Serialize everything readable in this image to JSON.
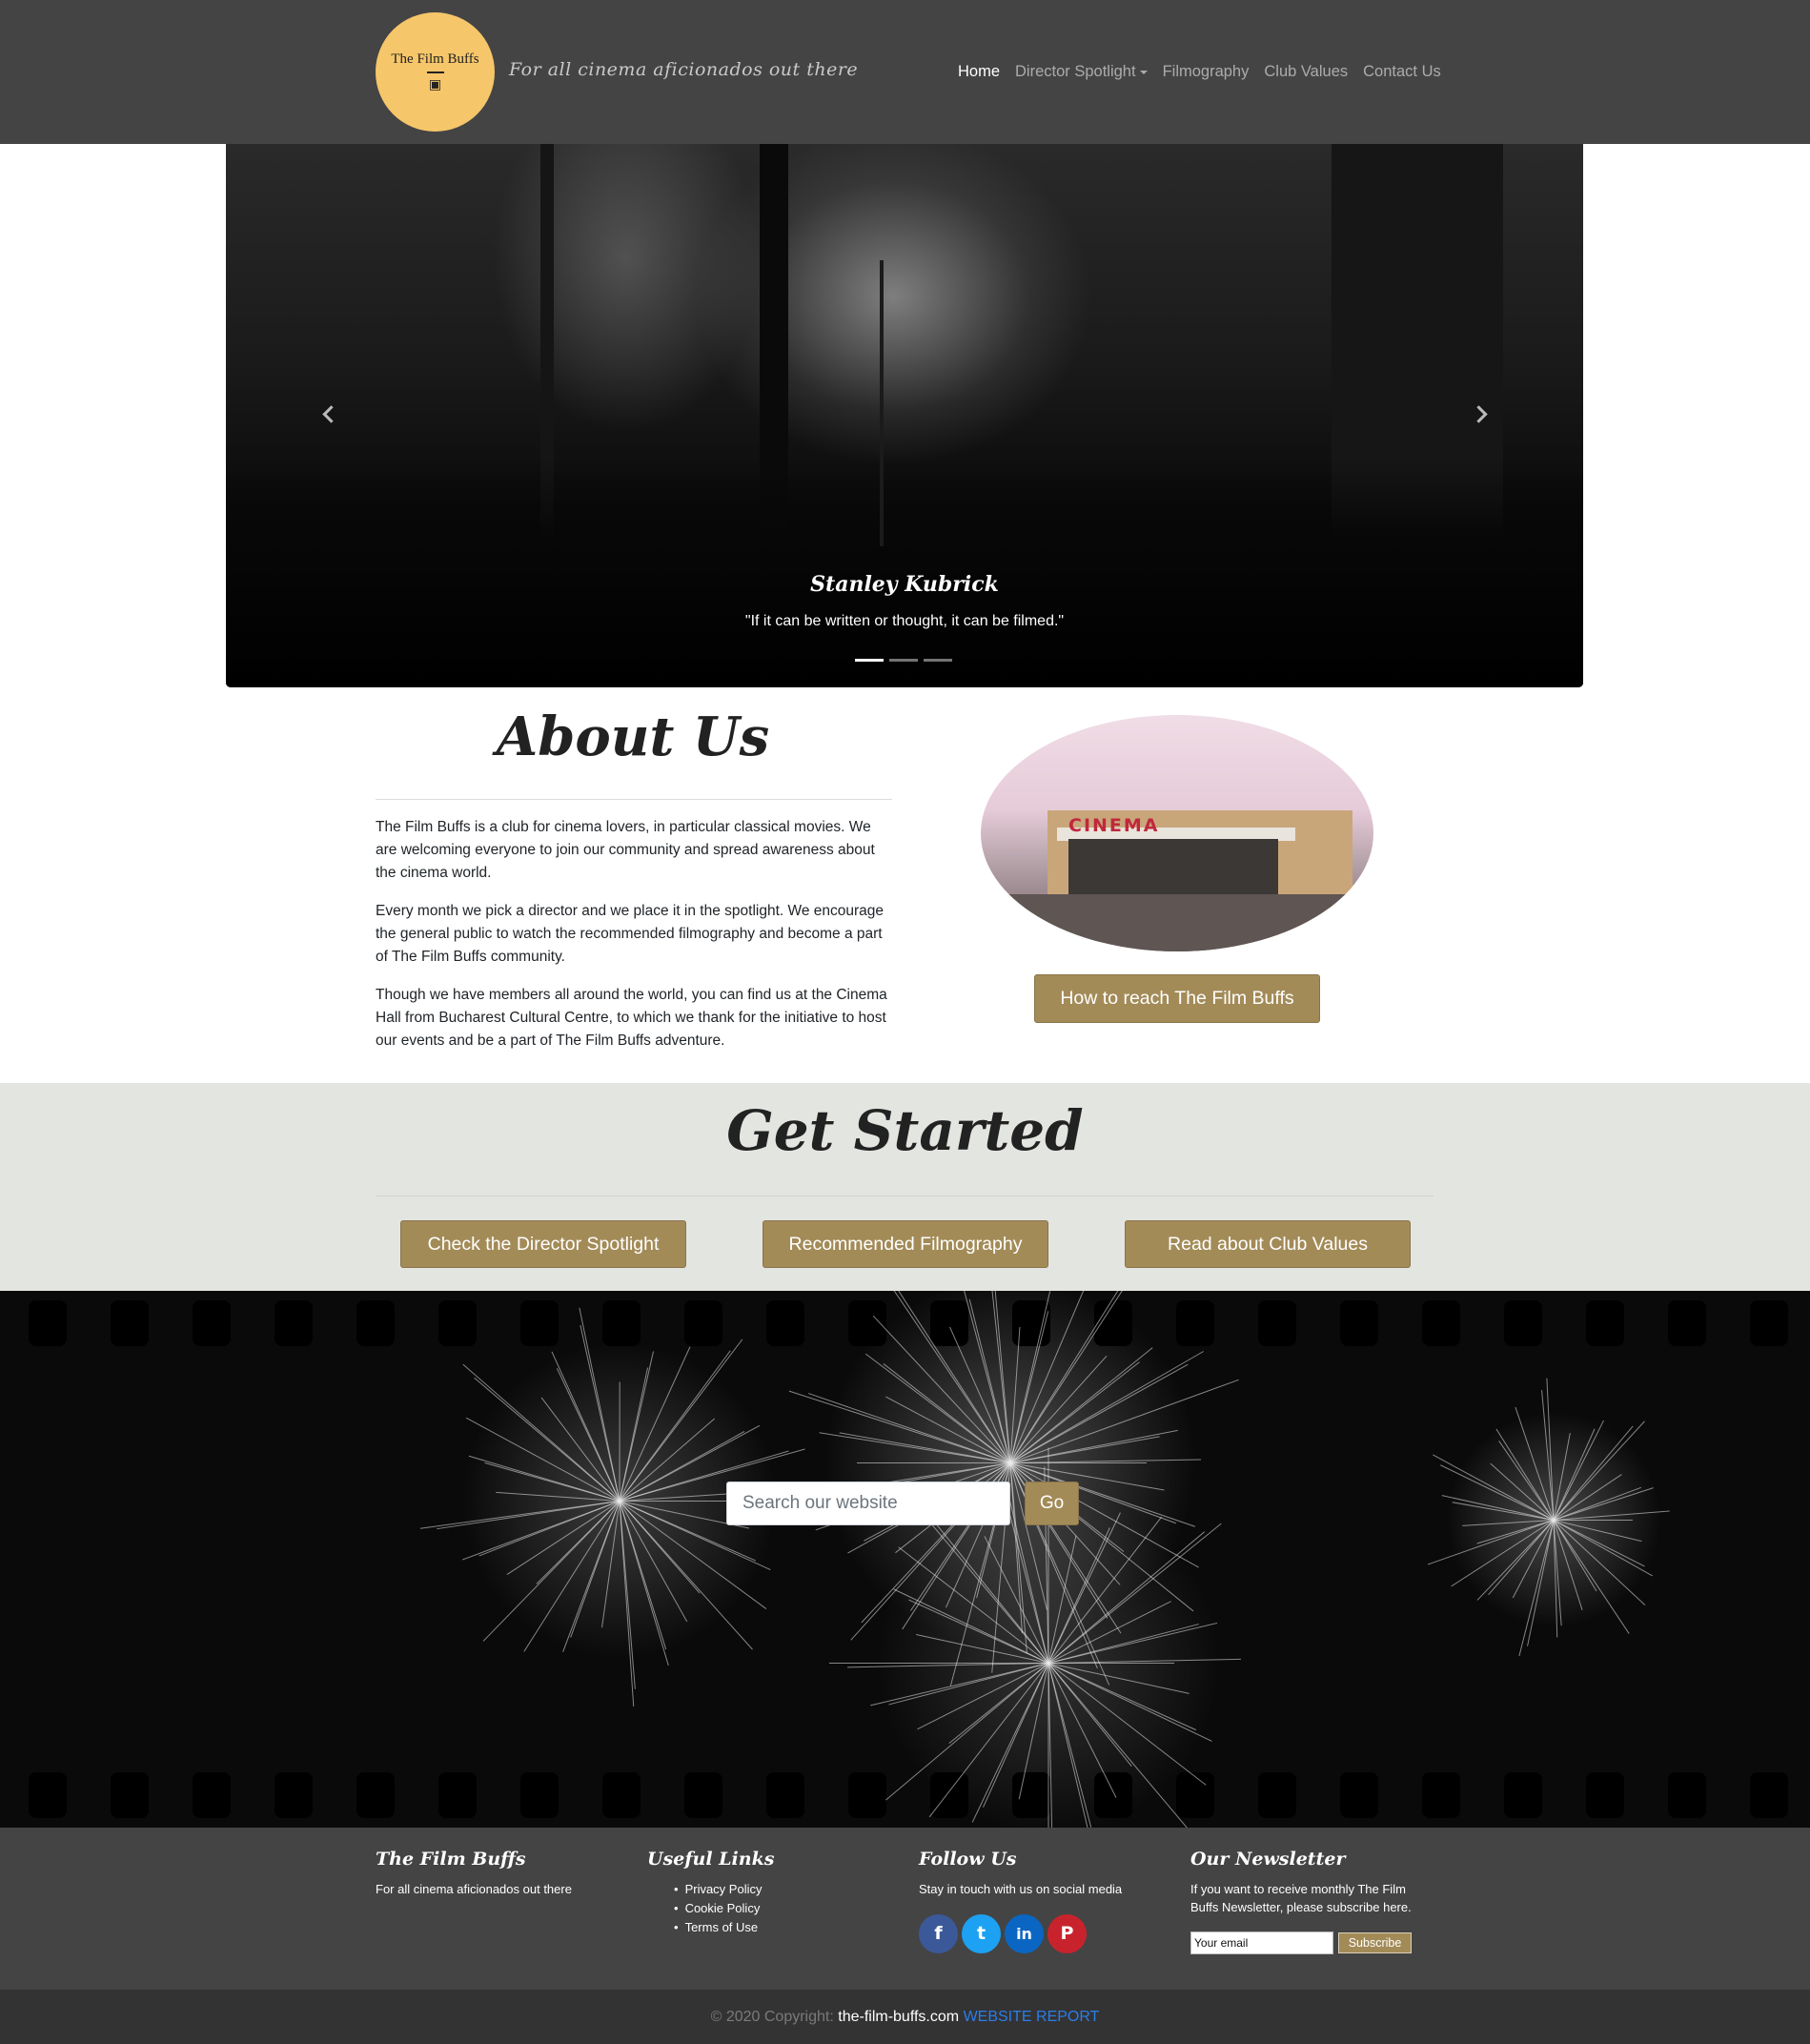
{
  "navbar": {
    "logo_text": "The Film Buffs",
    "tagline": "For all cinema aficionados out there",
    "links": [
      {
        "label": "Home",
        "active": true
      },
      {
        "label": "Director Spotlight",
        "dropdown": true
      },
      {
        "label": "Filmography"
      },
      {
        "label": "Club Values"
      },
      {
        "label": "Contact Us"
      }
    ]
  },
  "carousel": {
    "caption_title": "Stanley Kubrick",
    "caption_text": "\"If it can be written or thought, it can be filmed.\"",
    "slide_count": 3,
    "active_slide": 1
  },
  "about": {
    "title": "About Us",
    "paragraphs": [
      "The Film Buffs is a club for cinema lovers, in particular classical movies. We are welcoming everyone to join our community and spread awareness about the cinema world.",
      "Every month we pick a director and we place it in the spotlight. We encourage the general public to watch the recommended filmography and become a part of The Film Buffs community.",
      "Though we have members all around the world, you can find us at the Cinema Hall from Bucharest Cultural Centre, to which we thank for the initiative to host our events and be a part of The Film Buffs adventure."
    ],
    "image_sign": "CINEMA",
    "button": "How to reach The Film Buffs"
  },
  "get_started": {
    "title": "Get Started",
    "buttons": [
      "Check the Director Spotlight",
      "Recommended Filmography",
      "Read about Club Values"
    ]
  },
  "search": {
    "placeholder": "Search our website",
    "button": "Go"
  },
  "footer": {
    "col1": {
      "title": "The Film Buffs",
      "text": "For all cinema aficionados out there"
    },
    "col2": {
      "title": "Useful Links",
      "links": [
        "Privacy Policy",
        "Cookie Policy",
        "Terms of Use"
      ]
    },
    "col3": {
      "title": "Follow Us",
      "text": "Stay in touch with us on social media",
      "social": [
        {
          "icon": "facebook-icon",
          "glyph": "f",
          "color": "#3b5998"
        },
        {
          "icon": "twitter-icon",
          "glyph": "t",
          "color": "#1da1f2"
        },
        {
          "icon": "linkedin-icon",
          "glyph": "in",
          "color": "#0a66c2"
        },
        {
          "icon": "pinterest-icon",
          "glyph": "P",
          "color": "#c8232c"
        }
      ]
    },
    "col4": {
      "title": "Our Newsletter",
      "text": "If you want to receive monthly The Film Buffs Newsletter, please subscribe here.",
      "input_value": "Your email",
      "button": "Subscribe"
    }
  },
  "copyright": {
    "prefix": "© 2020 Copyright:",
    "site": "the-film-buffs.com",
    "report": "WEBSITE REPORT"
  },
  "colors": {
    "navbar_bg": "#444444",
    "logo_bg": "#f6c66a",
    "accent_gold": "#a38b58",
    "section_bg": "#e3e5e1",
    "copyright_bg": "#333333",
    "report_link": "#2b7de9"
  }
}
